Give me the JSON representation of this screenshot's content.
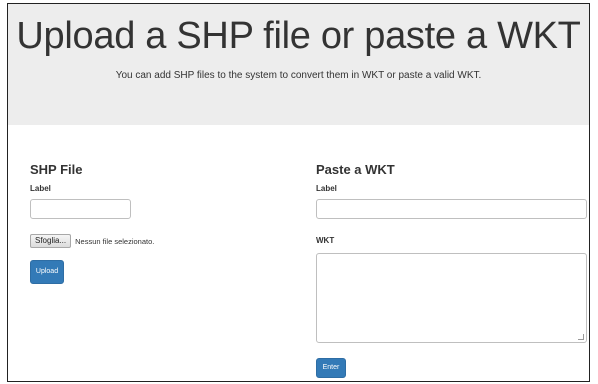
{
  "header": {
    "title": "Upload a SHP file or paste a WKT",
    "subtitle": "You can add SHP files to the system to convert them in WKT or paste a valid WKT."
  },
  "shp": {
    "heading": "SHP File",
    "label_caption": "Label",
    "label_value": "",
    "browse_label": "Sfoglia...",
    "file_status": "Nessun file selezionato.",
    "upload_label": "Upload"
  },
  "wkt": {
    "heading": "Paste a WKT",
    "label_caption": "Label",
    "label_value": "",
    "wkt_caption": "WKT",
    "wkt_value": "",
    "enter_label": "Enter"
  },
  "colors": {
    "jumbotron_bg": "#ededed",
    "primary_button": "#337ab7"
  }
}
